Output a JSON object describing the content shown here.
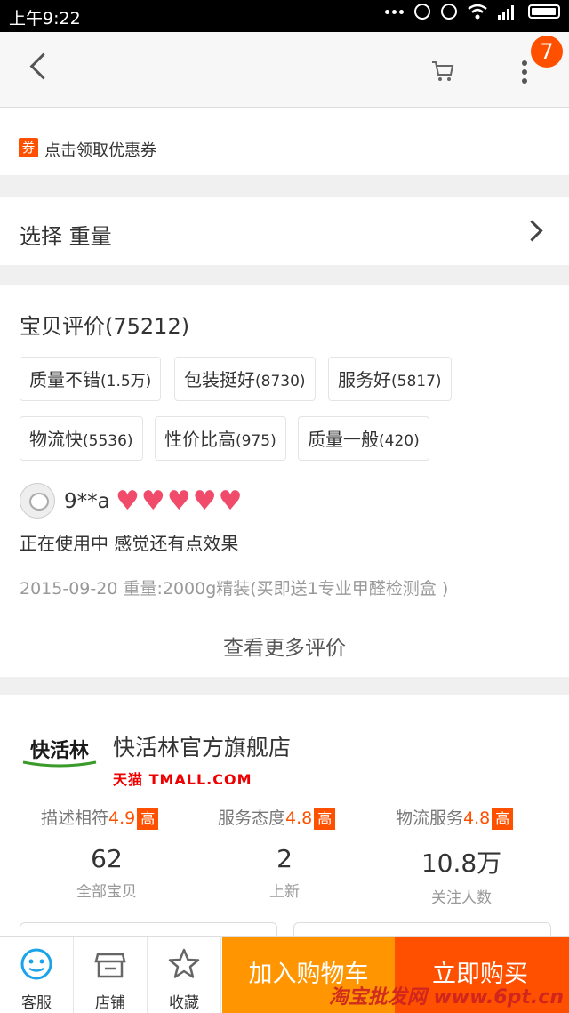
{
  "status_bar": {
    "time": "上午9:22"
  },
  "nav": {
    "badge_count": "7"
  },
  "coupon": {
    "tag": "券",
    "label": "点击领取优惠券"
  },
  "select": {
    "label": "选择 重量"
  },
  "reviews": {
    "title": "宝贝评价(75212)",
    "tags": [
      {
        "name": "质量不错",
        "count": "(1.5万)"
      },
      {
        "name": "包装挺好",
        "count": "(8730)"
      },
      {
        "name": "服务好",
        "count": "(5817)"
      },
      {
        "name": "物流快",
        "count": "(5536)"
      },
      {
        "name": "性价比高",
        "count": "(975)"
      },
      {
        "name": "质量一般",
        "count": "(420)"
      }
    ],
    "user": "9**a",
    "body": "正在使用中 感觉还有点效果",
    "meta": "2015-09-20 重量:2000g精装(买即送1专业甲醛检测盒 )",
    "more_label": "查看更多评价"
  },
  "shop": {
    "logo_text": "快活林",
    "name": "快活林官方旗舰店",
    "platform": "天猫 TMALL.COM",
    "ratings": [
      {
        "label": "描述相符",
        "score": "4.9",
        "level": "高"
      },
      {
        "label": "服务态度",
        "score": "4.8",
        "level": "高"
      },
      {
        "label": "物流服务",
        "score": "4.8",
        "level": "高"
      }
    ],
    "stats": [
      {
        "num": "62",
        "label": "全部宝贝"
      },
      {
        "num": "2",
        "label": "上新"
      },
      {
        "num": "10.8万",
        "label": "关注人数"
      }
    ]
  },
  "bottom": {
    "service": "客服",
    "store": "店铺",
    "favorite": "收藏",
    "add_cart": "加入购物车",
    "buy_now": "立即购买",
    "watermark": "淘宝批发网 www.6pt.cn"
  },
  "colors": {
    "accent": "#ff5000",
    "cart_button": "#ff9500"
  }
}
